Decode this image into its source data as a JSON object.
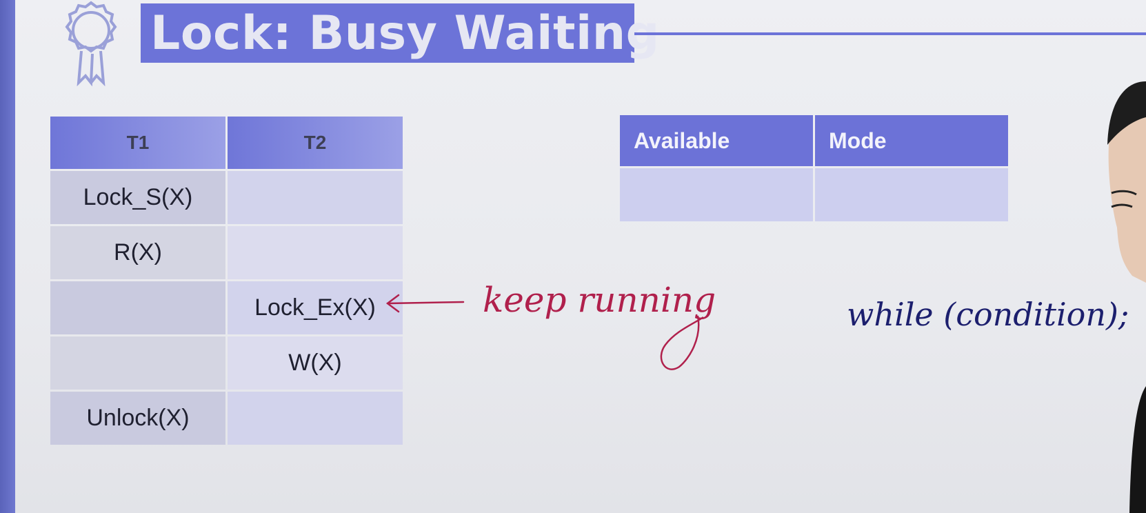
{
  "slide": {
    "title": "Lock: Busy Waiting",
    "badge_icon": "award-ribbon-icon",
    "accent": "#6c73d8"
  },
  "schedule_table": {
    "headers": [
      "T1",
      "T2"
    ],
    "rows": [
      [
        "Lock_S(X)",
        ""
      ],
      [
        "R(X)",
        ""
      ],
      [
        "",
        "Lock_Ex(X)"
      ],
      [
        "",
        "W(X)"
      ],
      [
        "Unlock(X)",
        ""
      ]
    ]
  },
  "status_table": {
    "headers": [
      "Available",
      "Mode"
    ],
    "rows": [
      [
        "",
        ""
      ]
    ]
  },
  "annotations": {
    "arrow_note": "keep running",
    "code_note": "while (condition);"
  }
}
